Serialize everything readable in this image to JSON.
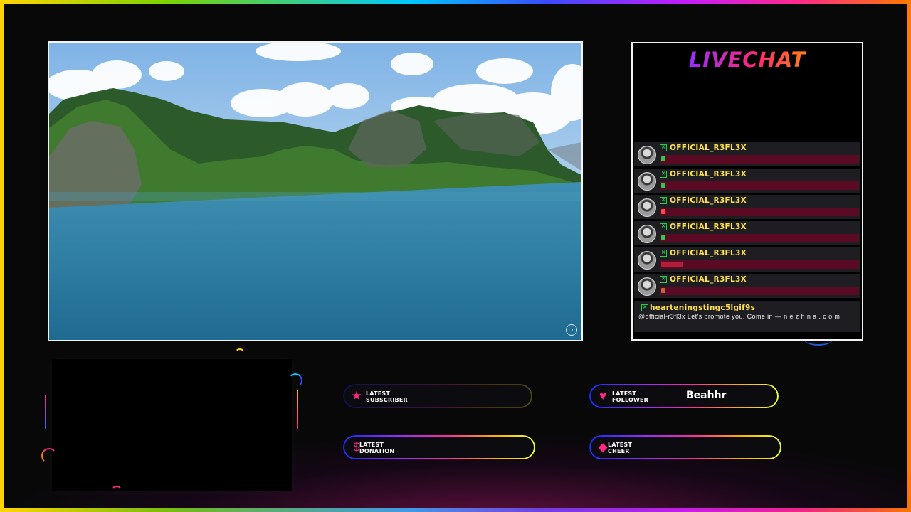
{
  "chat": {
    "title": "LIVECHAT",
    "messages": [
      {
        "user": "OFFICIAL_R3FL3X",
        "emote_color": "#1fd14a"
      },
      {
        "user": "OFFICIAL_R3FL3X",
        "emote_color": "#1fd14a"
      },
      {
        "user": "OFFICIAL_R3FL3X",
        "emote_color": "#ff4a4a"
      },
      {
        "user": "OFFICIAL_R3FL3X",
        "emote_color": "#1fd14a"
      },
      {
        "user": "OFFICIAL_R3FL3X",
        "emote_color": "#b01e3a"
      },
      {
        "user": "OFFICIAL_R3FL3X",
        "emote_color": "#c8643c"
      }
    ],
    "last_message": {
      "user": "hearteningstingc5lgif9s",
      "text": "@official-r3fl3x Let's promote you. Come in — n e z h n a . c o m"
    }
  },
  "stats": {
    "subscriber": {
      "label_line1": "LATEST",
      "label_line2": "SUBSCRIBER",
      "value": ""
    },
    "follower": {
      "label_line1": "LATEST",
      "label_line2": "FOLLOWER",
      "value": "Beahhr"
    },
    "donation": {
      "label_line1": "LATEST",
      "label_line2": "DONATION",
      "value": ""
    },
    "cheer": {
      "label_line1": "LATEST",
      "label_line2": "CHEER",
      "value": ""
    }
  },
  "icons": {
    "subscriber": "star-icon",
    "follower": "heart-icon",
    "donation": "dollar-icon",
    "cheer": "diamond-icon",
    "badge": "badge-icon"
  },
  "colors": {
    "accent_pink": "#ff2a7f",
    "username_yellow": "#ffe14a",
    "badge_green": "#1fd14a",
    "message_bar": "#5a0a22"
  }
}
